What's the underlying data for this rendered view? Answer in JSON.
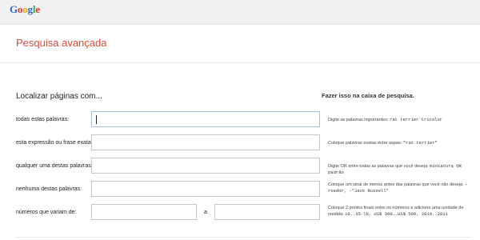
{
  "header": {
    "logo_letters": [
      "G",
      "o",
      "o",
      "g",
      "l",
      "e"
    ]
  },
  "page": {
    "title": "Pesquisa avançada"
  },
  "form": {
    "section_heading": "Localizar páginas com...",
    "hint_heading": "Fazer isso na caixa de pesquisa.",
    "rows": [
      {
        "label": "todas estas palavras:",
        "value": "",
        "hint_text": "Digite as palavras importantes:",
        "hint_code": "rat terrier tricolor"
      },
      {
        "label": "esta expressão ou frase exata:",
        "value": "",
        "hint_text": "Coloque palavras exatas entre aspas:",
        "hint_code": "\"rat terrier\""
      },
      {
        "label": "qualquer uma destas palavras:",
        "value": "",
        "hint_text": "Digite OR entre todas as palavras que você deseja:",
        "hint_code": "miniatura OR padrão"
      },
      {
        "label": "nenhuma destas palavras:",
        "value": "",
        "hint_text": "Coloque um sinal de menos antes das palavras que você não deseja:",
        "hint_code": "-roedor, -\"Jack Russell\""
      },
      {
        "label": "números que variam de:",
        "value_from": "",
        "range_separator": "a",
        "value_to": "",
        "hint_text": "Coloque 2 pontos finais entre os números e adicione uma unidade de medida:",
        "hint_code": "10..35 lb, US$ 300..US$ 500, 2010..2011"
      }
    ]
  },
  "colors": {
    "title": "#dd4b39",
    "logo_blue": "#3366cc",
    "logo_red": "#dd3322",
    "logo_yellow": "#eeaa11",
    "logo_green": "#33aa44"
  }
}
